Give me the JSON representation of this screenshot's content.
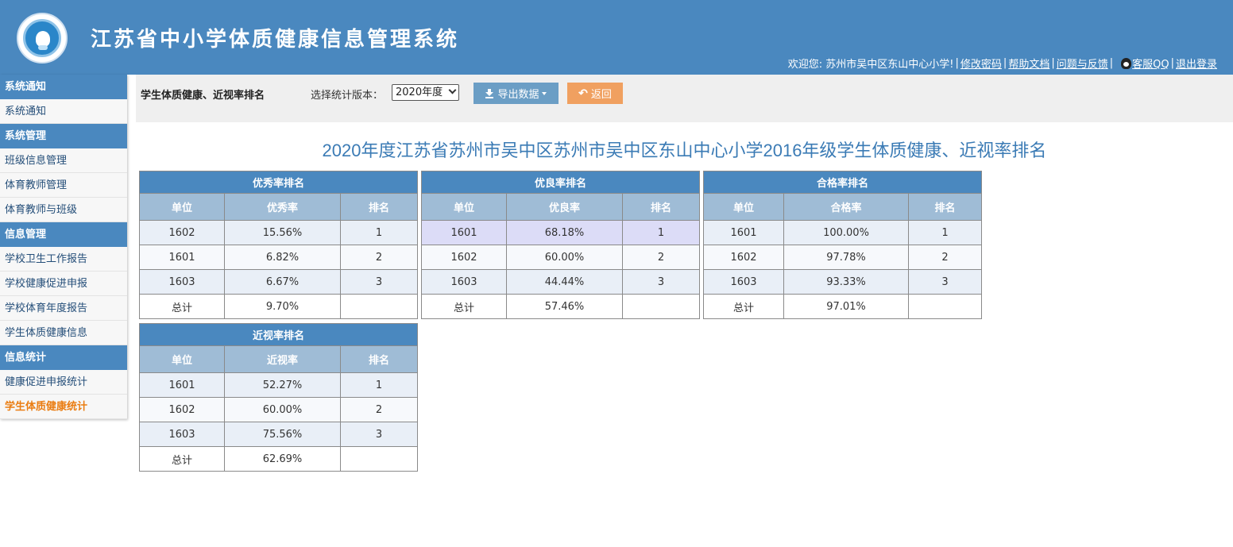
{
  "header": {
    "system_title": "江苏省中小学体质健康信息管理系统",
    "welcome": "欢迎您: 苏州市吴中区东山中心小学!",
    "links": {
      "change_password": "修改密码",
      "help_docs": "帮助文档",
      "feedback": "问题与反馈",
      "qq_service": "客服QQ",
      "logout": "退出登录"
    },
    "separator": "|"
  },
  "sidebar": {
    "sections": [
      {
        "title": "系统通知",
        "items": [
          "系统通知"
        ]
      },
      {
        "title": "系统管理",
        "items": [
          "班级信息管理",
          "体育教师管理",
          "体育教师与班级"
        ]
      },
      {
        "title": "信息管理",
        "items": [
          "学校卫生工作报告",
          "学校健康促进申报",
          "学校体育年度报告",
          "学生体质健康信息"
        ]
      },
      {
        "title": "信息统计",
        "items": [
          "健康促进申报统计",
          "学生体质健康统计"
        ]
      }
    ],
    "active_item": "学生体质健康统计"
  },
  "toolbar": {
    "page_title": "学生体质健康、近视率排名",
    "version_label": "选择统计版本：",
    "version_selected": "2020年度",
    "export_label": "导出数据",
    "back_label": "返回"
  },
  "report": {
    "title": "2020年度江苏省苏州市吴中区苏州市吴中区东山中心小学2016年级学生体质健康、近视率排名",
    "tables": [
      {
        "caption": "优秀率排名",
        "columns": [
          "单位",
          "优秀率",
          "排名"
        ],
        "rows": [
          [
            "1602",
            "15.56%",
            "1"
          ],
          [
            "1601",
            "6.82%",
            "2"
          ],
          [
            "1603",
            "6.67%",
            "3"
          ]
        ],
        "total": [
          "总计",
          "9.70%",
          ""
        ]
      },
      {
        "caption": "优良率排名",
        "columns": [
          "单位",
          "优良率",
          "排名"
        ],
        "rows": [
          [
            "1601",
            "68.18%",
            "1"
          ],
          [
            "1602",
            "60.00%",
            "2"
          ],
          [
            "1603",
            "44.44%",
            "3"
          ]
        ],
        "total": [
          "总计",
          "57.46%",
          ""
        ]
      },
      {
        "caption": "合格率排名",
        "columns": [
          "单位",
          "合格率",
          "排名"
        ],
        "rows": [
          [
            "1601",
            "100.00%",
            "1"
          ],
          [
            "1602",
            "97.78%",
            "2"
          ],
          [
            "1603",
            "93.33%",
            "3"
          ]
        ],
        "total": [
          "总计",
          "97.01%",
          ""
        ]
      },
      {
        "caption": "近视率排名",
        "columns": [
          "单位",
          "近视率",
          "排名"
        ],
        "rows": [
          [
            "1601",
            "52.27%",
            "1"
          ],
          [
            "1602",
            "60.00%",
            "2"
          ],
          [
            "1603",
            "75.56%",
            "3"
          ]
        ],
        "total": [
          "总计",
          "62.69%",
          ""
        ]
      }
    ]
  },
  "colors": {
    "header_blue": "#4a88bf",
    "column_header": "#9fbcd6",
    "export_button": "#6b9ec5",
    "back_button": "#f0a060",
    "active_nav": "#ea7d12",
    "title_blue": "#3b7bb5"
  }
}
